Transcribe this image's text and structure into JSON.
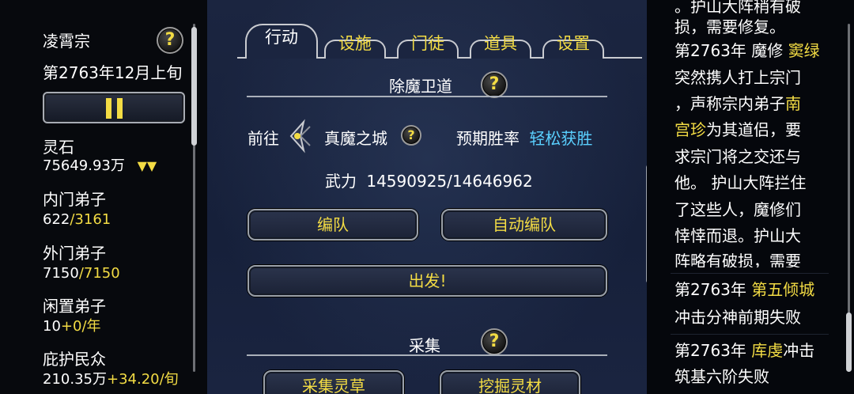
{
  "sidebar": {
    "sect_name": "凌霄宗",
    "date": "第2763年12月上旬",
    "spirit_stone": {
      "label": "灵石",
      "value": "75649.93万",
      "trend": "▼▼"
    },
    "inner_disciples": {
      "label": "内门弟子",
      "current": "622",
      "max": "/3161"
    },
    "outer_disciples": {
      "label": "外门弟子",
      "current": "7150",
      "max": "/7150"
    },
    "idle_disciples": {
      "label": "闲置弟子",
      "current": "10",
      "rate": "+0/年"
    },
    "protected_people": {
      "label": "庇护民众",
      "current": "210.35万",
      "rate": "+34.20/旬"
    },
    "help_glyph": "?",
    "pause_glyph": "pause"
  },
  "tabs": [
    {
      "label": "行动",
      "active": true
    },
    {
      "label": "设施",
      "active": false
    },
    {
      "label": "门徒",
      "active": false
    },
    {
      "label": "道具",
      "active": false
    },
    {
      "label": "设置",
      "active": false
    }
  ],
  "demon_guard": {
    "title": "除魔卫道",
    "goto_label": "前往",
    "destination": "真魔之城",
    "win_rate_label": "预期胜率",
    "win_rate_value": "轻松获胜",
    "force_label": "武力",
    "force_value": "14590925/14646962",
    "form_team_button": "编队",
    "auto_team_button": "自动编队",
    "depart_button": "出发!"
  },
  "gather": {
    "title": "采集",
    "herb_button": "采集灵草",
    "mine_button": "挖掘灵材"
  },
  "log": {
    "entry0": [
      {
        "text": "。护山大阵稍有破"
      },
      {
        "text": "损，需要修复。"
      }
    ],
    "entry1": [
      {
        "parts": [
          "第2763年 魔修 ",
          "窦绿"
        ]
      },
      {
        "parts": [
          "突然携人打上宗门",
          ""
        ]
      },
      {
        "parts": [
          "，声称宗内弟子",
          "南"
        ]
      },
      {
        "parts": [
          "",
          "宫珍",
          "为其道侣，要"
        ]
      },
      {
        "parts": [
          "求宗门将之交还与",
          ""
        ]
      },
      {
        "parts": [
          "他。 护山大阵拦住",
          ""
        ]
      },
      {
        "parts": [
          "了这些人，魔修们",
          ""
        ]
      },
      {
        "parts": [
          "悻悻而退。护山大",
          ""
        ]
      },
      {
        "parts": [
          "阵略有破损，需要",
          ""
        ]
      }
    ],
    "entry2": {
      "prefix": "第2763年 ",
      "name": "第五倾城",
      "line2": "冲击分神前期失败"
    },
    "entry3": {
      "prefix": "第2763年 ",
      "name": "库虔",
      "suffix": "冲击",
      "line2": "筑基六阶失败"
    }
  },
  "colors": {
    "highlight": "#f3dc44",
    "win_rate": "#5ad0ff",
    "panel_bg": "#1b2540"
  }
}
